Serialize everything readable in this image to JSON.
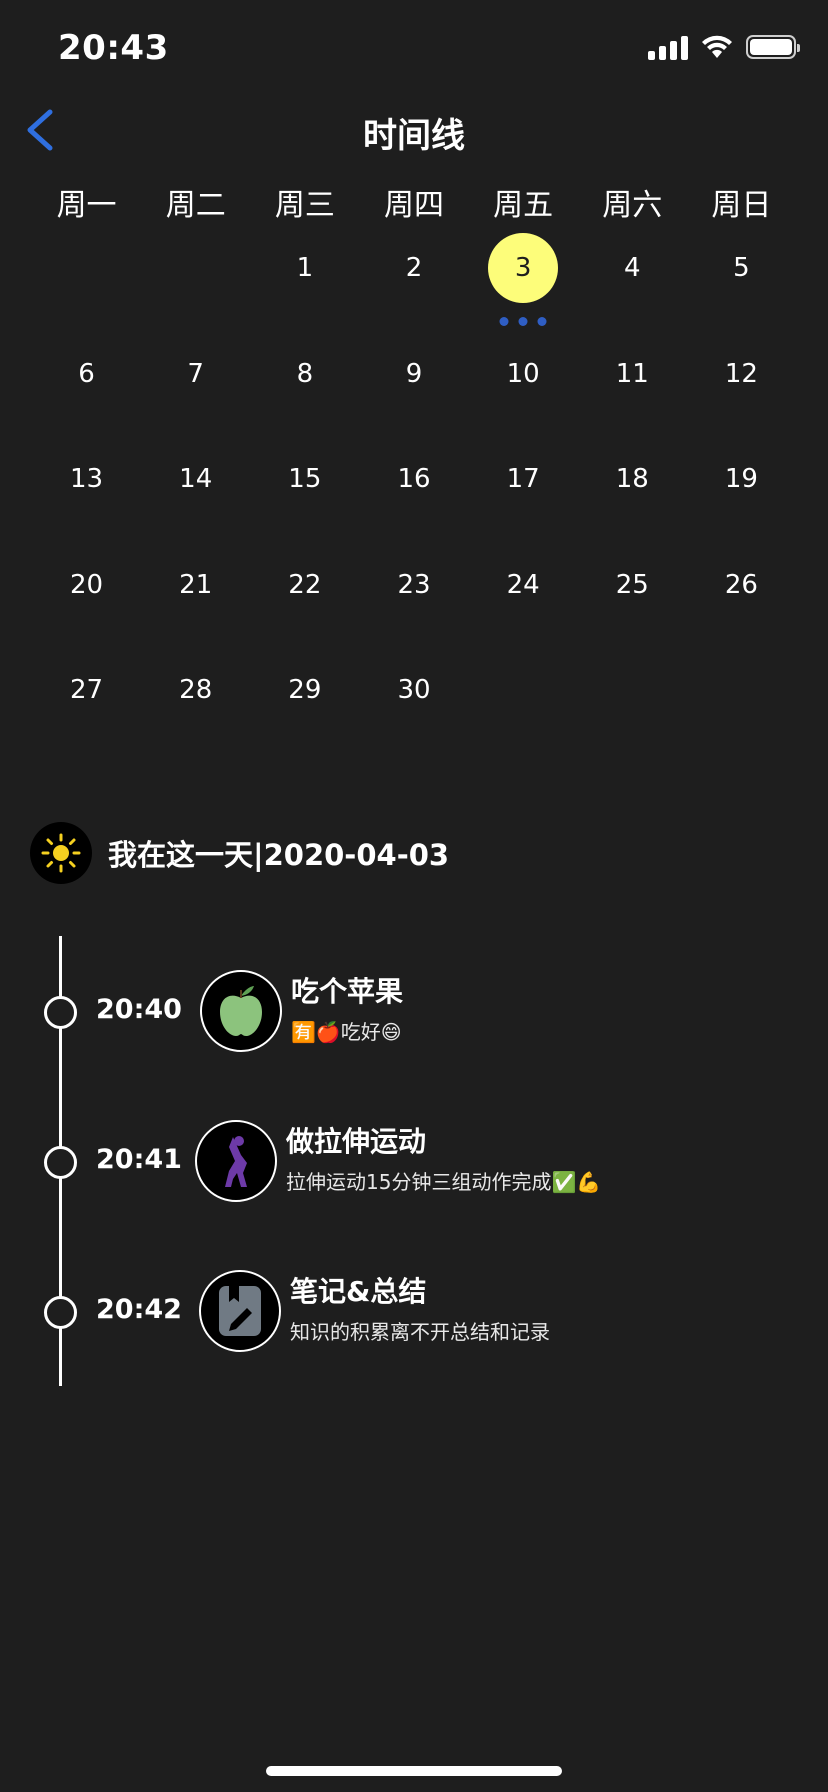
{
  "status_bar": {
    "time": "20:43"
  },
  "nav": {
    "title": "时间线"
  },
  "calendar": {
    "weekdays": [
      "周一",
      "周二",
      "周三",
      "周四",
      "周五",
      "周六",
      "周日"
    ],
    "leading_blanks": 2,
    "days": [
      "1",
      "2",
      "3",
      "4",
      "5",
      "6",
      "7",
      "8",
      "9",
      "10",
      "11",
      "12",
      "13",
      "14",
      "15",
      "16",
      "17",
      "18",
      "19",
      "20",
      "21",
      "22",
      "23",
      "24",
      "25",
      "26",
      "27",
      "28",
      "29",
      "30"
    ],
    "selected_day": "3",
    "selected_color": "#fdfd7a",
    "event_dot_color": "#2f5ec4",
    "event_dot_count": 3
  },
  "day_header": {
    "text": "我在这一天|2020-04-03",
    "icon": "sun-icon"
  },
  "timeline": [
    {
      "time": "20:40",
      "title": "吃个苹果",
      "desc": "🈶🍎吃好😄",
      "icon": "apple-icon"
    },
    {
      "time": "20:41",
      "title": "做拉伸运动",
      "desc": "拉伸运动15分钟三组动作完成✅💪",
      "icon": "stretch-icon"
    },
    {
      "time": "20:42",
      "title": "笔记&总结",
      "desc": "知识的积累离不开总结和记录",
      "icon": "note-icon"
    }
  ]
}
